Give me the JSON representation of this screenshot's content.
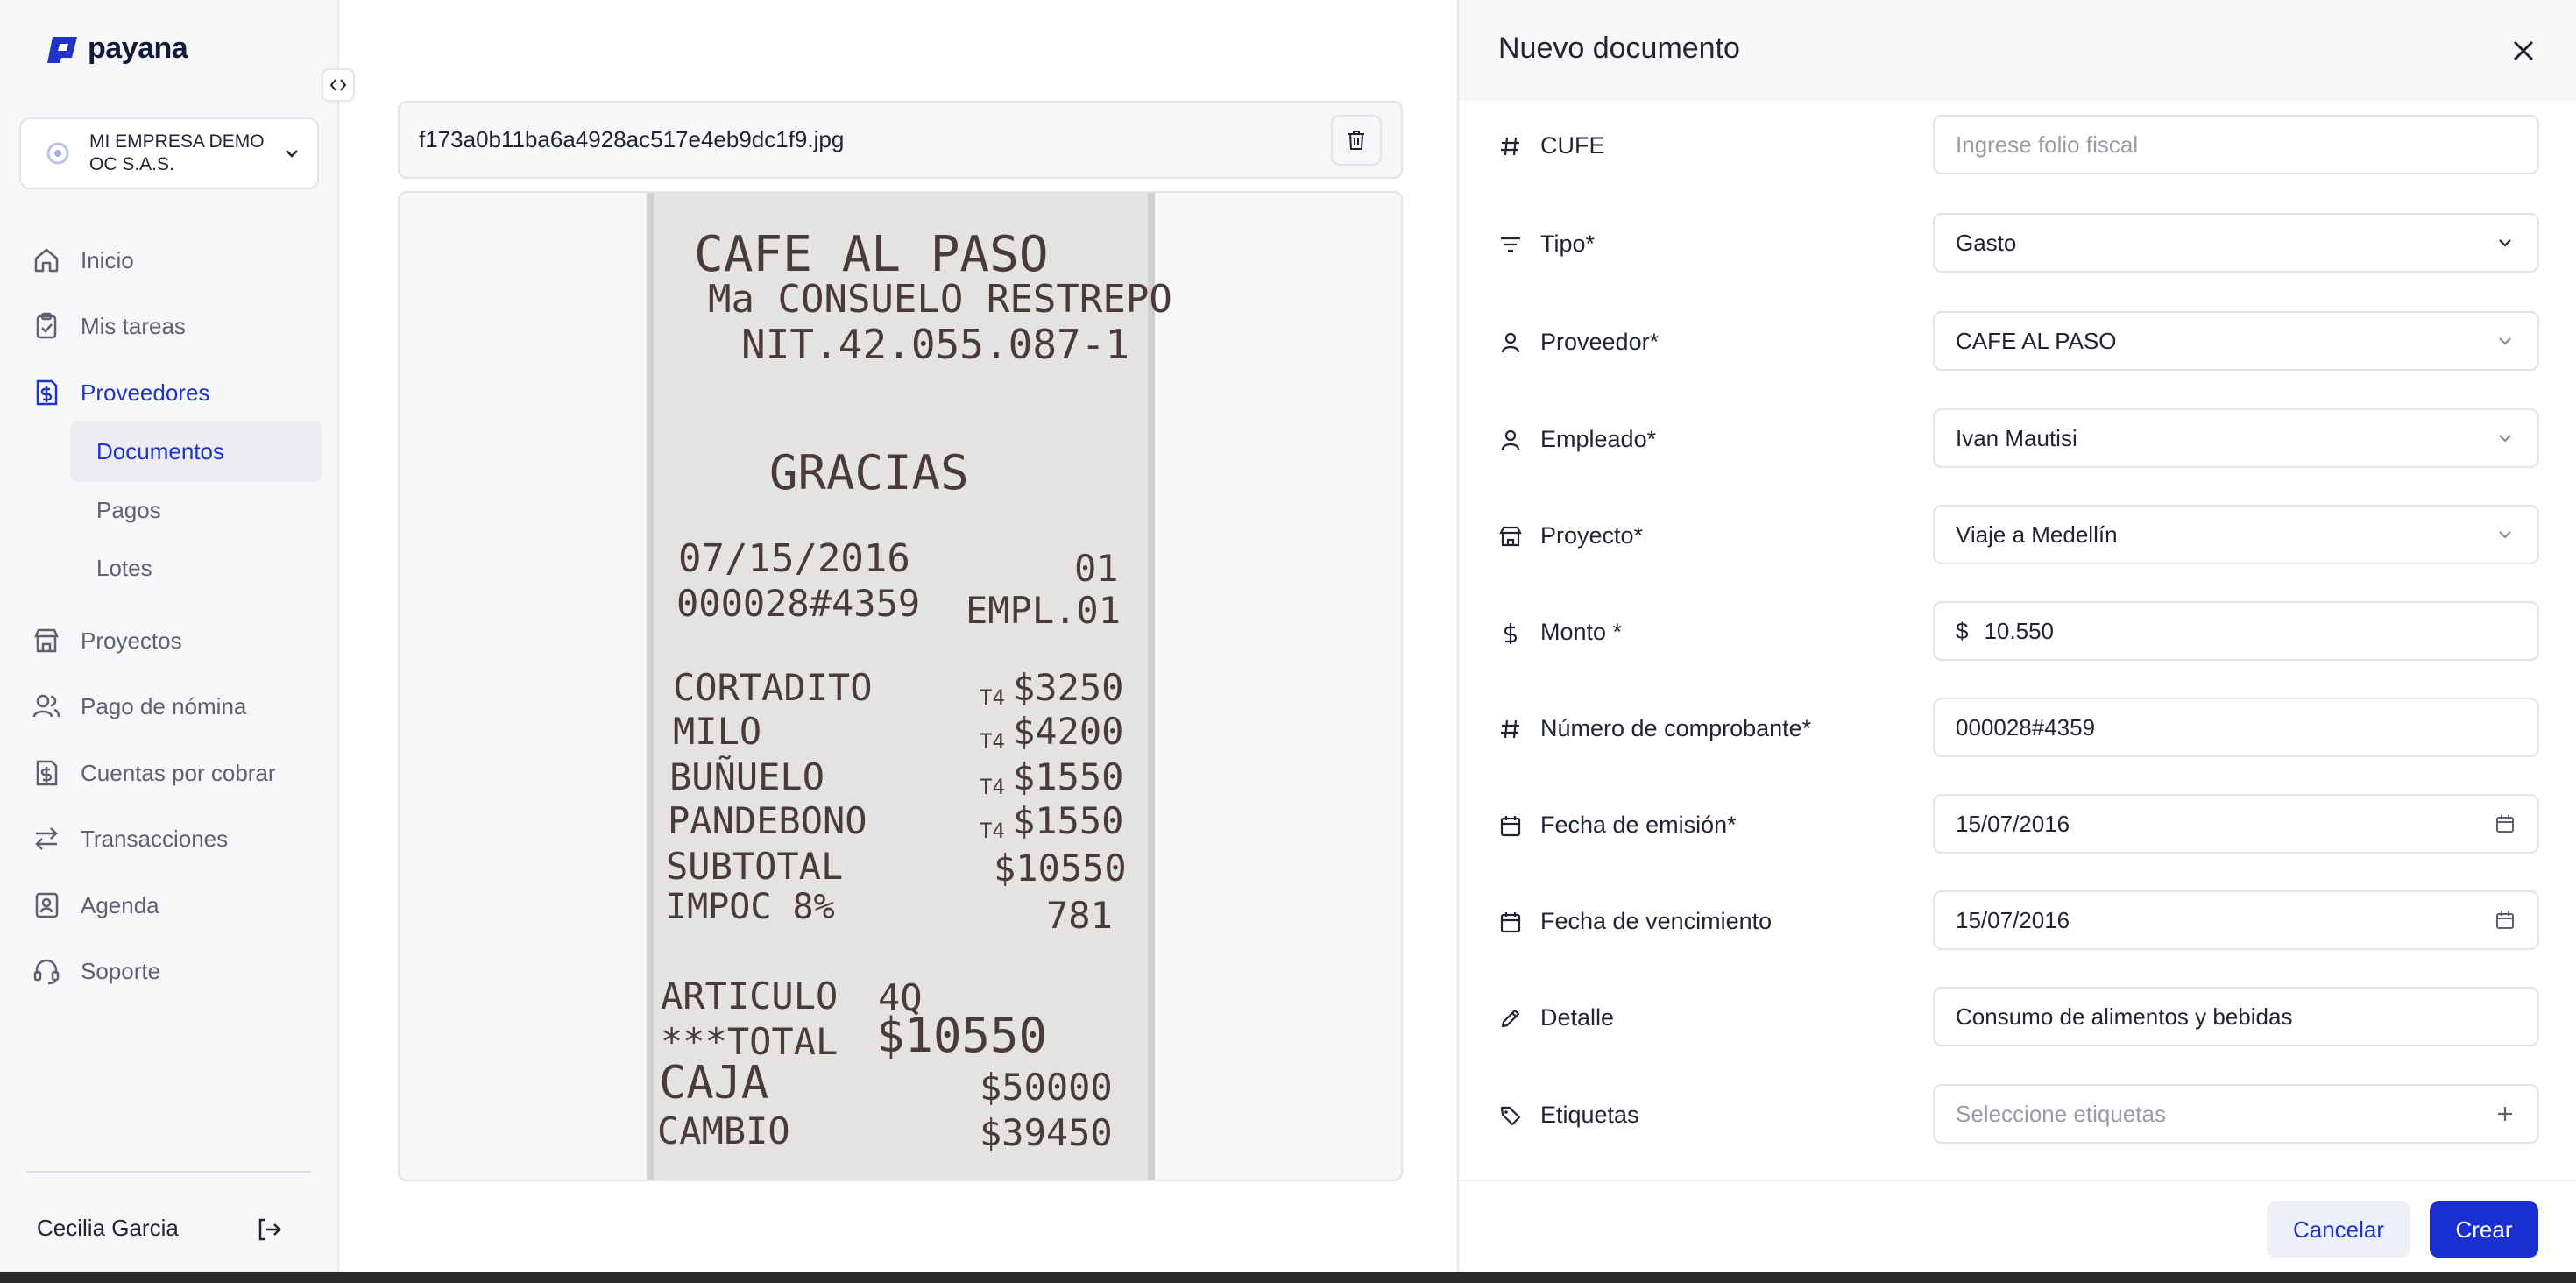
{
  "brand": {
    "name": "payana",
    "color": "#1f33c9"
  },
  "sidebar": {
    "company": "MI EMPRESA DEMO OC S.A.S.",
    "nav": [
      {
        "label": "Inicio",
        "icon": "home-icon"
      },
      {
        "label": "Mis tareas",
        "icon": "clipboard-check-icon"
      },
      {
        "label": "Proveedores",
        "icon": "invoice-dollar-icon"
      },
      {
        "label": "Proyectos",
        "icon": "store-icon"
      },
      {
        "label": "Pago de nómina",
        "icon": "users-icon"
      },
      {
        "label": "Cuentas por cobrar",
        "icon": "invoice-dollar-icon"
      },
      {
        "label": "Transacciones",
        "icon": "arrows-exchange-icon"
      },
      {
        "label": "Agenda",
        "icon": "contact-book-icon"
      },
      {
        "label": "Soporte",
        "icon": "headset-icon"
      }
    ],
    "sub_nav": [
      "Documentos",
      "Pagos",
      "Lotes"
    ],
    "user": "Cecilia Garcia"
  },
  "preview": {
    "file_name": "f173a0b11ba6a4928ac517e4eb9dc1f9.jpg",
    "receipt": {
      "title": "CAFE AL PASO",
      "owner": "Ma CONSUELO RESTREPO",
      "nit": "NIT.42.055.087-1",
      "thanks": "GRACIAS",
      "date": "07/15/2016",
      "date_code": "01",
      "ticket": "000028#4359",
      "employee": "EMPL.01",
      "items": [
        {
          "name": "CORTADITO",
          "tax": "T4",
          "price": "$3250"
        },
        {
          "name": "MILO",
          "tax": "T4",
          "price": "$4200"
        },
        {
          "name": "BUÑUELO",
          "tax": "T4",
          "price": "$1550"
        },
        {
          "name": "PANDEBONO",
          "tax": "T4",
          "price": "$1550"
        }
      ],
      "subtotal_label": "SUBTOTAL",
      "subtotal": "$10550",
      "tax_label": "IMPOC 8%",
      "tax": "781",
      "articles_label": "ARTICULO",
      "articles": "4Q",
      "total_label": "***TOTAL",
      "total": "$10550",
      "cash_label": "CAJA",
      "cash": "$50000",
      "change_label": "CAMBIO",
      "change": "$39450"
    }
  },
  "drawer": {
    "title": "Nuevo documento",
    "fields": [
      {
        "label": "CUFE",
        "icon": "hash-icon",
        "placeholder": "Ingrese folio fiscal",
        "value": "",
        "suffix": ""
      },
      {
        "label": "Tipo*",
        "icon": "filter-lines-icon",
        "placeholder": "",
        "value": "Gasto",
        "suffix": "chevron-down-icon"
      },
      {
        "label": "Proveedor*",
        "icon": "user-icon",
        "placeholder": "",
        "value": "CAFE AL PASO",
        "suffix": "chevron-down-icon"
      },
      {
        "label": "Empleado*",
        "icon": "user-icon",
        "placeholder": "",
        "value": "Ivan Mautisi",
        "suffix": "chevron-down-icon"
      },
      {
        "label": "Proyecto*",
        "icon": "store-icon",
        "placeholder": "",
        "value": "Viaje a Medellín",
        "suffix": "chevron-down-icon"
      },
      {
        "label": "Monto *",
        "icon": "dollar-icon",
        "placeholder": "",
        "value": "10.550",
        "prefix": "$",
        "suffix": ""
      },
      {
        "label": "Número de comprobante*",
        "icon": "hash-icon",
        "placeholder": "",
        "value": "000028#4359",
        "suffix": ""
      },
      {
        "label": "Fecha de emisión*",
        "icon": "calendar-icon",
        "placeholder": "",
        "value": "15/07/2016",
        "suffix": "calendar-icon"
      },
      {
        "label": "Fecha de vencimiento",
        "icon": "calendar-icon",
        "placeholder": "",
        "value": "15/07/2016",
        "suffix": "calendar-icon"
      },
      {
        "label": "Detalle",
        "icon": "pencil-icon",
        "placeholder": "",
        "value": "Consumo de alimentos y bebidas",
        "suffix": ""
      },
      {
        "label": "Etiquetas",
        "icon": "tag-icon",
        "placeholder": "Seleccione etiquetas",
        "value": "",
        "suffix": "plus-icon"
      }
    ],
    "cancel": "Cancelar",
    "create": "Crear"
  }
}
